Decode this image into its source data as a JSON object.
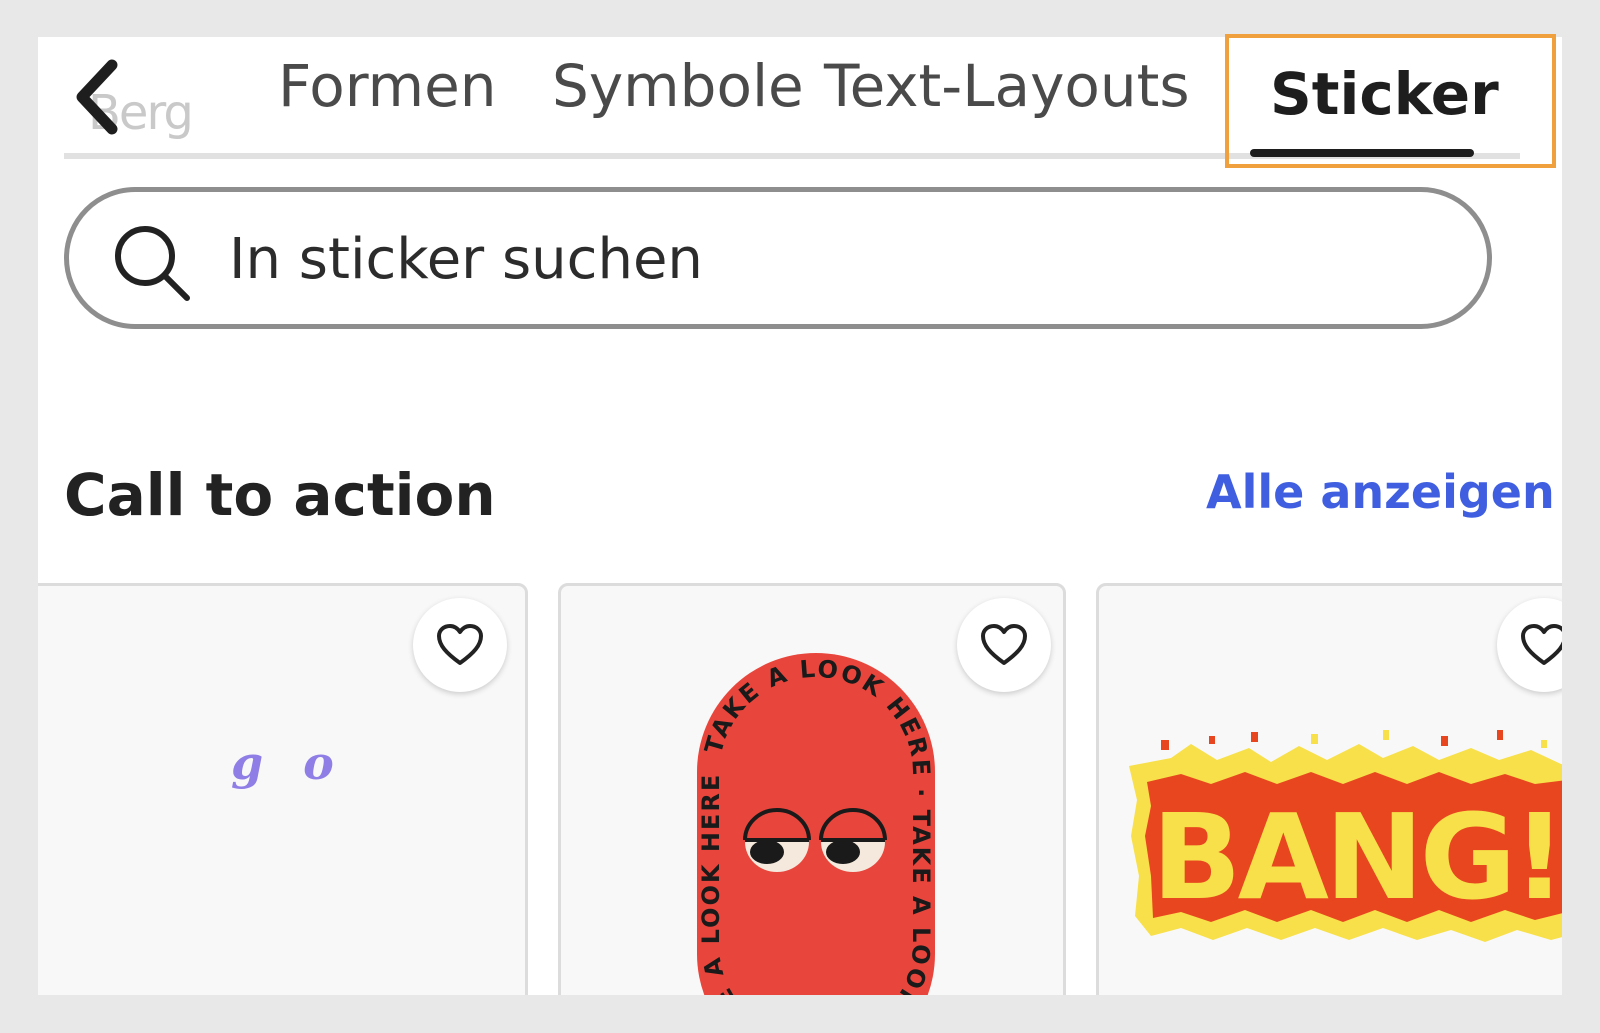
{
  "tabs": {
    "back_label": "Berg",
    "items": [
      {
        "label": "Formen",
        "active": false
      },
      {
        "label": "Symbole",
        "active": false
      },
      {
        "label": "Text-Layouts",
        "active": false
      },
      {
        "label": "Sticker",
        "active": true
      }
    ]
  },
  "search": {
    "placeholder": "In sticker suchen",
    "icon": "search-icon"
  },
  "section": {
    "title": "Call to action",
    "see_all_label": "Alle anzeigen"
  },
  "cards": [
    {
      "name": "go",
      "text": "g o",
      "favorite_icon": "heart-outline-icon"
    },
    {
      "name": "take-a-look-here",
      "text": "TAKE A LOOK HERE · TAKE A LOOK HERE · TAKE A LOOK HERE ·",
      "favorite_icon": "heart-outline-icon"
    },
    {
      "name": "bang",
      "text": "BANG!",
      "favorite_icon": "heart-outline-icon"
    }
  ],
  "colors": {
    "accent_link": "#3f5fe0",
    "active_tab_underline": "#1e1e1e",
    "highlight_box": "#f0a03c",
    "sticker_red": "#e8463c",
    "bang_yellow": "#f7e04a",
    "bang_orange": "#e8461e",
    "go_purple": "#8f7ee6"
  }
}
